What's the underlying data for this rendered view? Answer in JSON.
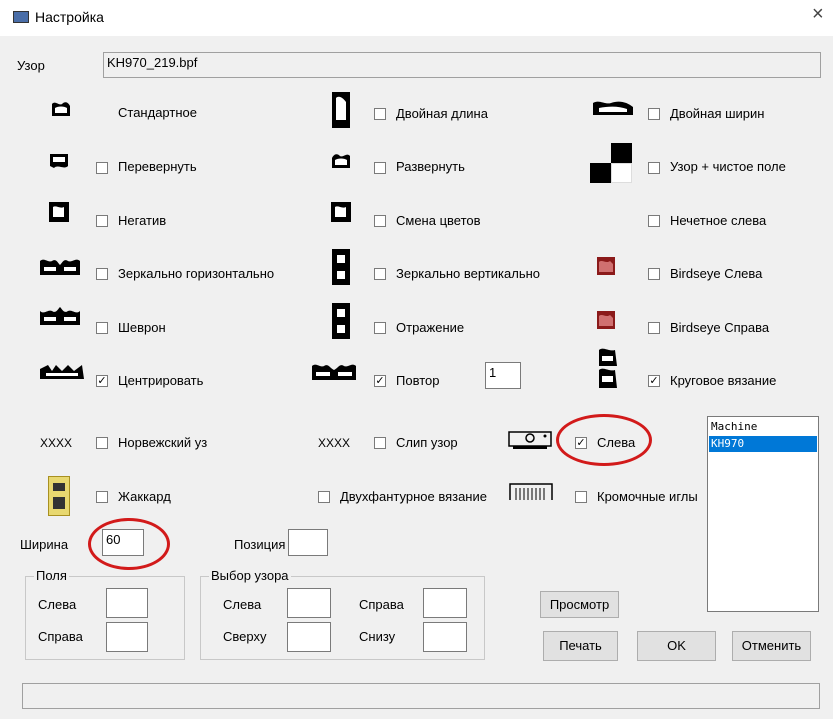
{
  "window": {
    "title": "Настройка",
    "close_glyph": "×"
  },
  "pattern": {
    "label": "Узор",
    "filename": "KH970_219.bpf"
  },
  "options": {
    "standard": "Стандартное",
    "double_length": "Двойная длина",
    "double_width": "Двойная ширин",
    "flip": "Перевернуть",
    "rotate": "Развернуть",
    "pattern_blank": "Узор + чистое поле",
    "negative": "Негатив",
    "color_change": "Смена цветов",
    "odd_left": "Нечетное слева",
    "mirror_h": "Зеркально горизонтально",
    "mirror_v": "Зеркально вертикально",
    "birdseye_left": "Birdseye Слева",
    "chevron": "Шеврон",
    "reflection": "Отражение",
    "birdseye_right": "Birdseye Справа",
    "center": "Центрировать",
    "repeat": "Повтор",
    "repeat_value": "1",
    "circular": "Круговое вязание",
    "norwegian": "Норвежский уз",
    "slip": "Слип узор",
    "left": "Слева",
    "jacquard": "Жаккард",
    "double_bed": "Двухфантурное вязание",
    "edge_needles": "Кромочные иглы",
    "xxxx1": "XXXX",
    "xxxx2": "XXXX"
  },
  "machine_list": {
    "header": "Machine",
    "items": [
      "KH970"
    ]
  },
  "dims": {
    "width_label": "Ширина",
    "width_value": "60",
    "position_label": "Позиция",
    "position_value": ""
  },
  "margins": {
    "title": "Поля",
    "left_label": "Слева",
    "right_label": "Справа"
  },
  "selection": {
    "title": "Выбор узора",
    "left_label": "Слева",
    "right_label": "Справа",
    "top_label": "Сверху",
    "bottom_label": "Снизу"
  },
  "buttons": {
    "preview": "Просмотр",
    "print": "Печать",
    "ok": "OK",
    "cancel": "Отменить"
  },
  "colors": {
    "annotation": "#d21a1a",
    "selection": "#0078d7"
  }
}
